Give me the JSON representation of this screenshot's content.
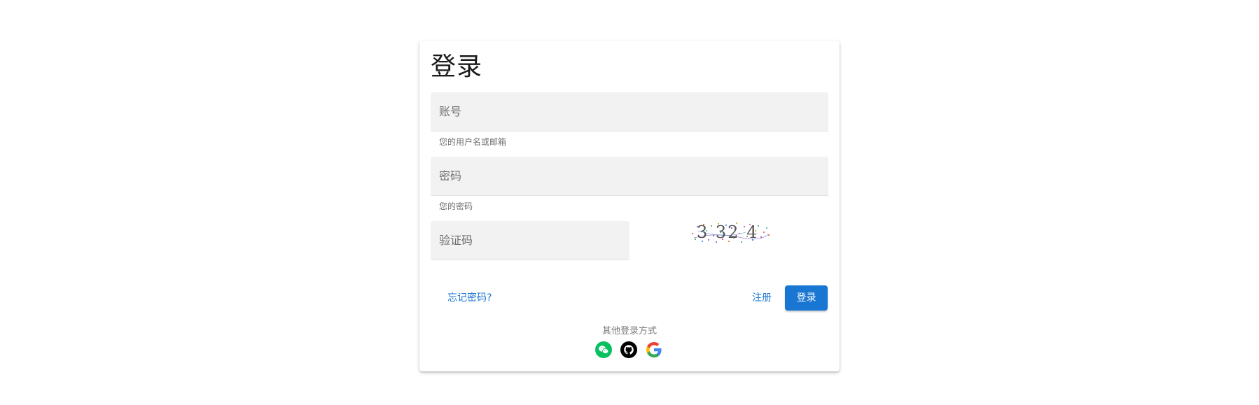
{
  "login": {
    "title": "登录",
    "account": {
      "placeholder": "账号",
      "value": "",
      "hint": "您的用户名或邮箱"
    },
    "password": {
      "placeholder": "密码",
      "value": "",
      "hint": "您的密码"
    },
    "captcha": {
      "placeholder": "验证码",
      "value": "",
      "image_text": "3 32 4"
    },
    "forgot_password_label": "忘记密码?",
    "register_label": "注册",
    "login_button_label": "登录",
    "other_methods_label": "其他登录方式",
    "social_icons": [
      "wechat-icon",
      "github-icon",
      "google-icon"
    ]
  },
  "colors": {
    "primary": "#1976d2",
    "field_bg": "#f2f2f2",
    "wechat": "#07c160",
    "github": "#000000"
  }
}
